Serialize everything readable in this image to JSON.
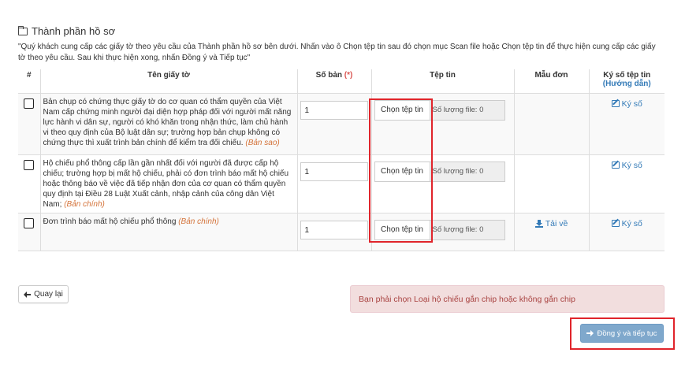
{
  "section": {
    "title": "Thành phần hồ sơ",
    "instruction": "\"Quý khách cung cấp các giấy tờ theo yêu cầu của Thành phần hồ sơ bên dưới. Nhấn vào ô Chọn tệp tin sau đó chọn mục Scan file hoặc Chọn tệp tin để thực hiện cung cấp các giấy tờ theo yêu cầu. Sau khi thực hiện xong, nhấn Đồng ý và Tiếp tục\""
  },
  "table": {
    "headers": {
      "index": "#",
      "name": "Tên giấy tờ",
      "quantity": "Số bản",
      "quantity_required": "(*)",
      "file": "Tệp tin",
      "template": "Mẫu đơn",
      "sign": "Ký số tệp tin",
      "sign_guide": "(Hướng dẫn)"
    },
    "rows": [
      {
        "name": "Bản chụp có chứng thực giấy tờ do cơ quan có thẩm quyền của Việt Nam cấp chứng minh người đại diện hợp pháp đối với người mất năng lực hành vi dân sự, người có khó khăn trong nhận thức, làm chủ hành vi theo quy định của Bộ luật dân sự; trường hợp bản chụp không có chứng thực thì xuất trình bản chính để kiểm tra đối chiếu.",
        "type": "(Bản sao)",
        "quantity": "1",
        "file_button": "Chọn tệp tin",
        "file_count": "Số lượng file: 0",
        "template_link": "",
        "sign_link": "Ký số"
      },
      {
        "name": "Hộ chiếu phổ thông cấp lần gần nhất đối với người đã được cấp hộ chiếu; trường hợp bị mất hộ chiếu, phải có đơn trình báo mất hộ chiếu hoặc thông báo về việc đã tiếp nhận đơn của cơ quan có thẩm quyền quy định tại Điều 28 Luật Xuất cảnh, nhập cảnh của công dân Việt Nam;",
        "type": "(Bản chính)",
        "quantity": "1",
        "file_button": "Chọn tệp tin",
        "file_count": "Số lượng file: 0",
        "template_link": "",
        "sign_link": "Ký số"
      },
      {
        "name": "Đơn trình báo mất hộ chiếu phổ thông",
        "type": "(Bản chính)",
        "quantity": "1",
        "file_button": "Chọn tệp tin",
        "file_count": "Số lượng file: 0",
        "template_link": "Tải về",
        "sign_link": "Ký số"
      }
    ]
  },
  "actions": {
    "back_label": "Quay lại",
    "alert_text": "Bạn phải chọn Loại hộ chiếu gắn chip hoặc không gắn chip",
    "next_label": "Đồng ý và tiếp tục"
  },
  "colors": {
    "link": "#337ab7",
    "highlight": "#e0242b",
    "alert_bg": "#f2dede",
    "alert_text": "#a94442",
    "next_button": "#7fa8cc"
  }
}
